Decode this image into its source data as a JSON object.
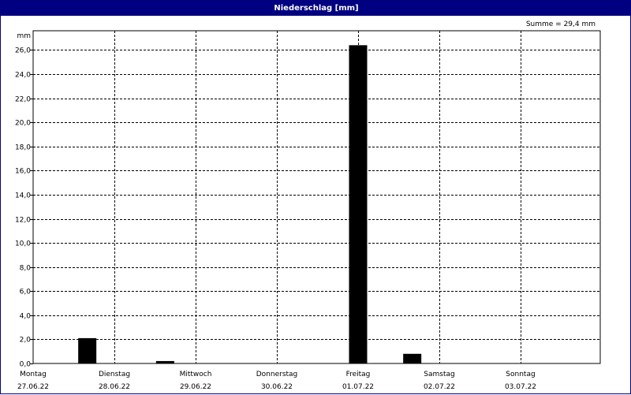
{
  "window": {
    "title": "Niederschlag [mm]"
  },
  "summary": "Summe = 29,4 mm",
  "colors": {
    "titlebar": "#000080",
    "bars": "#000000",
    "grid": "#000000"
  },
  "chart_data": {
    "type": "bar",
    "title": "Niederschlag [mm]",
    "ylabel": "mm",
    "xlabel": "",
    "ylim": [
      0,
      27.6
    ],
    "yticks": [
      "0,0",
      "2,0",
      "4,0",
      "6,0",
      "8,0",
      "10,0",
      "12,0",
      "14,0",
      "16,0",
      "18,0",
      "20,0",
      "22,0",
      "24,0",
      "26,0"
    ],
    "ytick_values": [
      0,
      2,
      4,
      6,
      8,
      10,
      12,
      14,
      16,
      18,
      20,
      22,
      24,
      26
    ],
    "days": [
      {
        "weekday": "Montag",
        "date": "27.06.22"
      },
      {
        "weekday": "Dienstag",
        "date": "28.06.22"
      },
      {
        "weekday": "Mittwoch",
        "date": "29.06.22"
      },
      {
        "weekday": "Donnerstag",
        "date": "30.06.22"
      },
      {
        "weekday": "Freitag",
        "date": "01.07.22"
      },
      {
        "weekday": "Samstag",
        "date": "02.07.22"
      },
      {
        "weekday": "Sonntag",
        "date": "03.07.22"
      }
    ],
    "bars": [
      {
        "date": "27.06.22",
        "hour": 16,
        "value": 2.1
      },
      {
        "date": "28.06.22",
        "hour": 15,
        "value": 0.2
      },
      {
        "date": "01.07.22",
        "hour": 0,
        "value": 26.4
      },
      {
        "date": "01.07.22",
        "hour": 16,
        "value": 0.8
      }
    ],
    "grid": true,
    "legend": "none"
  }
}
